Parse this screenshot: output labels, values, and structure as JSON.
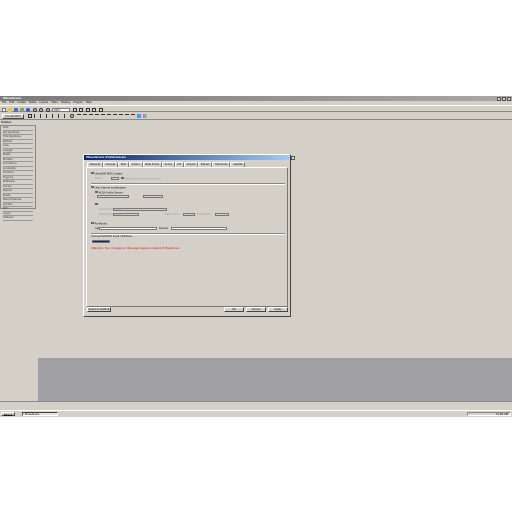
{
  "app": {
    "title": "MuseScore",
    "menus": [
      "File",
      "Edit",
      "Create",
      "Notes",
      "Layout",
      "Style",
      "Display",
      "Plugins",
      "Help"
    ]
  },
  "toolbar": {
    "zoom": "100%",
    "page_mode": "Concert Pitch"
  },
  "palette": {
    "label": "Palettes",
    "items": [
      "Clefs",
      "Key Signatures",
      "Time Signatures",
      "Barlines",
      "Lines",
      "Arpeggio",
      "Breath",
      "Brackets",
      "Articulations",
      "Accidentals",
      "Dynamics",
      "Fingering",
      "Noteheads",
      "Tremolo",
      "Repeats",
      "Breaks",
      "Beam Properties",
      "Symbols",
      "Text",
      "Layout",
      "Fretboard"
    ]
  },
  "dialog": {
    "title": "MuseScore Preferences",
    "tabs": [
      "General",
      "Canvas",
      "Text",
      "Colors",
      "New Score",
      "Score",
      "I/O",
      "Import",
      "Export",
      "Shortcuts",
      "Update"
    ],
    "active_tab": "I/O",
    "use_jack_midi": "Use JACK MIDI output",
    "ports_label": "Ports",
    "ports_value": "1",
    "remember_connections": "Remember last connections",
    "use_internal_synth": "Use internal synthesizer",
    "alsa_audio": "ALSA Audio Server",
    "alsa_device_label": "ALSA Device",
    "alsa_device_value": "default",
    "sample_rate_label": "Sample Rate",
    "sample_rate_value": "48000",
    "period_size_label": "Period Size",
    "period_size_value": "1024",
    "fragments_label": "Fragments",
    "fragments_value": "3",
    "portaudio_label": "PortAudio",
    "api_label": "Api",
    "device_label": "Device",
    "portmidi_label": "Choose PortMidi input interface:",
    "portmidi_value": "",
    "warning": "Attention: Your changes on this page require a restart of MuseScore.",
    "reset_button": "Reset to Default",
    "ok_button": "OK",
    "cancel_button": "Cancel",
    "apply_button": "Apply"
  },
  "taskbar": {
    "start": "Start",
    "task": "MuseScore",
    "clock": "11:40 AM"
  },
  "colors": {
    "desktop": "#d4d0c8",
    "title_active": "#0a246a",
    "warning": "#e00000"
  }
}
